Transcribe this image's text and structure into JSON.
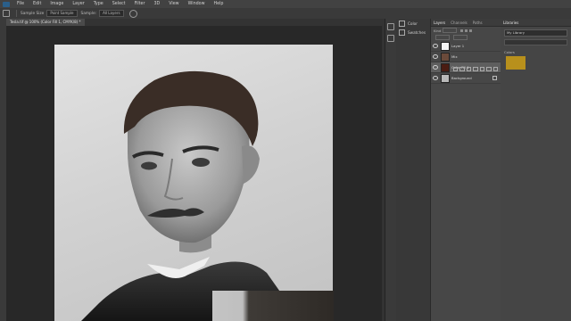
{
  "menu": [
    "File",
    "Edit",
    "Image",
    "Layer",
    "Type",
    "Select",
    "Filter",
    "3D",
    "View",
    "Window",
    "Help"
  ],
  "options_bar": {
    "sample_btn": "Sample Size",
    "sample_value": "Point Sample",
    "sample_label": "Sample:",
    "sample_layers": "All Layers"
  },
  "document": {
    "tab_title": "Tesla.tif @ 100% (Color Fill 1, CMYK/8) *"
  },
  "adjust_panel": {
    "items": [
      "Color",
      "Swatches"
    ]
  },
  "layers_panel": {
    "tabs": [
      "Layers",
      "Channels",
      "Paths"
    ],
    "filter_label": "Kind",
    "layers": [
      {
        "name": "Layer 1",
        "thumb": "#f4f4f4",
        "selected": false,
        "lock": false
      },
      {
        "name": "Mix",
        "thumb": "#6a4a3a",
        "selected": false,
        "lock": false
      },
      {
        "name": "Color Fill 1",
        "thumb": "#4a1c12",
        "selected": true,
        "lock": false
      },
      {
        "name": "Background",
        "thumb": "#b9b9b9",
        "selected": false,
        "lock": true
      }
    ]
  },
  "library": {
    "tab": "Libraries",
    "name": "My Library",
    "section": "Colors",
    "swatch_color": "#b8901c"
  },
  "colors": {
    "accent": "#2a5f8a"
  }
}
